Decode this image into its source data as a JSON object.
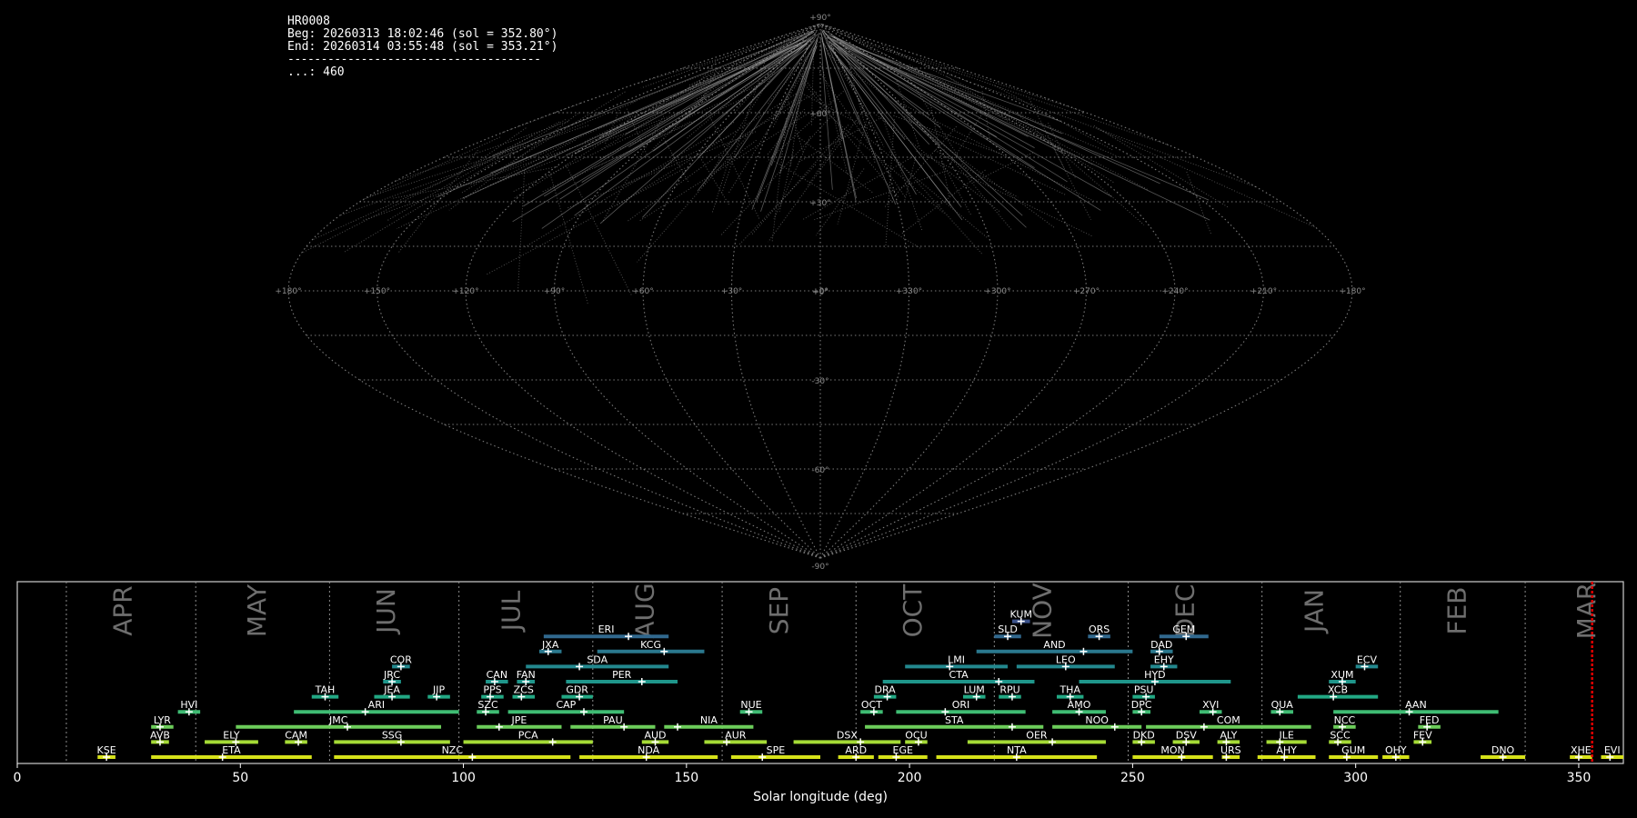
{
  "header": {
    "station": "HR0008",
    "beg": "Beg: 20260313 18:02:46 (sol = 352.80°)",
    "end": "End: 20260314 03:55:48 (sol = 353.21°)",
    "separator": "--------------------------------------",
    "count": "...: 460"
  },
  "sky_map": {
    "projection": "sinusoidal",
    "ra_labels": [
      "+180°",
      "+150°",
      "+120°",
      "+90°",
      "+60°",
      "+30°",
      "+0°",
      "+330°",
      "+300°",
      "+270°",
      "+240°",
      "+210°",
      "+180°"
    ],
    "dec_labels": [
      "+90°",
      "+60°",
      "+30°",
      "+0°",
      "-30°",
      "-60°",
      "-90°"
    ]
  },
  "chart_data": {
    "type": "range",
    "xlabel": "Solar longitude (deg)",
    "xlim": [
      0,
      360
    ],
    "xticks": [
      0,
      50,
      100,
      150,
      200,
      250,
      300,
      350
    ],
    "grid": true,
    "current_sol": 353.0,
    "months": [
      {
        "name": "APR",
        "boundary": 11,
        "label": 24
      },
      {
        "name": "MAY",
        "boundary": 40,
        "label": 54
      },
      {
        "name": "JUN",
        "boundary": 70,
        "label": 83
      },
      {
        "name": "JUL",
        "boundary": 99,
        "label": 111
      },
      {
        "name": "AUG",
        "boundary": 129,
        "label": 141
      },
      {
        "name": "SEP",
        "boundary": 158,
        "label": 171
      },
      {
        "name": "OCT",
        "boundary": 188,
        "label": 201
      },
      {
        "name": "NOV",
        "boundary": 219,
        "label": 230
      },
      {
        "name": "DEC",
        "boundary": 249,
        "label": 262
      },
      {
        "name": "JAN",
        "boundary": 279,
        "label": 291
      },
      {
        "name": "FEB",
        "boundary": 310,
        "label": 323
      },
      {
        "name": "MAR",
        "boundary": 338,
        "label": 352
      }
    ],
    "showers": [
      {
        "code": "KUM",
        "start": 223,
        "end": 227,
        "peak": 225,
        "row": 9
      },
      {
        "code": "ERI",
        "start": 118,
        "end": 146,
        "peak": 137,
        "row": 8
      },
      {
        "code": "SLD",
        "start": 219,
        "end": 225,
        "peak": 222,
        "row": 8
      },
      {
        "code": "ORS",
        "start": 240,
        "end": 245,
        "peak": 242.5,
        "row": 8
      },
      {
        "code": "GEM",
        "start": 256,
        "end": 267,
        "peak": 262,
        "row": 8
      },
      {
        "code": "JXA",
        "start": 117,
        "end": 122,
        "peak": 119,
        "row": 7
      },
      {
        "code": "KCG",
        "start": 130,
        "end": 154,
        "peak": 145,
        "row": 7
      },
      {
        "code": "AND",
        "start": 215,
        "end": 250,
        "peak": 239,
        "row": 7
      },
      {
        "code": "DAD",
        "start": 254,
        "end": 259,
        "peak": 256,
        "row": 7
      },
      {
        "code": "COR",
        "start": 84,
        "end": 88,
        "peak": 86,
        "row": 6
      },
      {
        "code": "SDA",
        "start": 114,
        "end": 146,
        "peak": 126,
        "row": 6
      },
      {
        "code": "LMI",
        "start": 199,
        "end": 222,
        "peak": 209,
        "row": 6
      },
      {
        "code": "LEO",
        "start": 224,
        "end": 246,
        "peak": 235,
        "row": 6
      },
      {
        "code": "EHY",
        "start": 254,
        "end": 260,
        "peak": 257,
        "row": 6
      },
      {
        "code": "ECV",
        "start": 300,
        "end": 305,
        "peak": 302,
        "row": 6
      },
      {
        "code": "JRC",
        "start": 82,
        "end": 86,
        "peak": 84,
        "row": 5
      },
      {
        "code": "CAN",
        "start": 105,
        "end": 110,
        "peak": 107,
        "row": 5
      },
      {
        "code": "FAN",
        "start": 112,
        "end": 116,
        "peak": 114,
        "row": 5
      },
      {
        "code": "PER",
        "start": 123,
        "end": 148,
        "peak": 140,
        "row": 5
      },
      {
        "code": "CTA",
        "start": 194,
        "end": 228,
        "peak": 220,
        "row": 5
      },
      {
        "code": "HYD",
        "start": 238,
        "end": 272,
        "peak": 255,
        "row": 5
      },
      {
        "code": "XUM",
        "start": 294,
        "end": 300,
        "peak": 297,
        "row": 5
      },
      {
        "code": "TAH",
        "start": 66,
        "end": 72,
        "peak": 69,
        "row": 4
      },
      {
        "code": "JEA",
        "start": 80,
        "end": 88,
        "peak": 84,
        "row": 4
      },
      {
        "code": "JIP",
        "start": 92,
        "end": 97,
        "peak": 94,
        "row": 4
      },
      {
        "code": "PPS",
        "start": 104,
        "end": 109,
        "peak": 106,
        "row": 4
      },
      {
        "code": "ZCS",
        "start": 111,
        "end": 116,
        "peak": 113,
        "row": 4
      },
      {
        "code": "GDR",
        "start": 122,
        "end": 129,
        "peak": 126,
        "row": 4
      },
      {
        "code": "DRA",
        "start": 192,
        "end": 197,
        "peak": 195,
        "row": 4
      },
      {
        "code": "LUM",
        "start": 212,
        "end": 217,
        "peak": 215,
        "row": 4
      },
      {
        "code": "RPU",
        "start": 220,
        "end": 225,
        "peak": 223,
        "row": 4
      },
      {
        "code": "THA",
        "start": 233,
        "end": 239,
        "peak": 236,
        "row": 4
      },
      {
        "code": "PSU",
        "start": 250,
        "end": 255,
        "peak": 253,
        "row": 4
      },
      {
        "code": "XCB",
        "start": 287,
        "end": 305,
        "peak": 295,
        "row": 4
      },
      {
        "code": "HVI",
        "start": 36,
        "end": 41,
        "peak": 38.5,
        "row": 3
      },
      {
        "code": "ARI",
        "start": 62,
        "end": 99,
        "peak": 78,
        "row": 3
      },
      {
        "code": "SZC",
        "start": 103,
        "end": 108,
        "peak": 105,
        "row": 3
      },
      {
        "code": "CAP",
        "start": 110,
        "end": 136,
        "peak": 127,
        "row": 3
      },
      {
        "code": "NUE",
        "start": 162,
        "end": 167,
        "peak": 164,
        "row": 3
      },
      {
        "code": "OCT",
        "start": 189,
        "end": 194,
        "peak": 192,
        "row": 3
      },
      {
        "code": "ORI",
        "start": 197,
        "end": 226,
        "peak": 208,
        "row": 3
      },
      {
        "code": "AMO",
        "start": 232,
        "end": 244,
        "peak": 238,
        "row": 3
      },
      {
        "code": "DPC",
        "start": 250,
        "end": 254,
        "peak": 252,
        "row": 3
      },
      {
        "code": "XVI",
        "start": 265,
        "end": 270,
        "peak": 268,
        "row": 3
      },
      {
        "code": "QUA",
        "start": 281,
        "end": 286,
        "peak": 283,
        "row": 3
      },
      {
        "code": "AAN",
        "start": 295,
        "end": 332,
        "peak": 312,
        "row": 3
      },
      {
        "code": "LYR",
        "start": 30,
        "end": 35,
        "peak": 32,
        "row": 2
      },
      {
        "code": "JMC",
        "start": 49,
        "end": 95,
        "peak": 74,
        "row": 2
      },
      {
        "code": "JPE",
        "start": 103,
        "end": 122,
        "peak": 108,
        "row": 2
      },
      {
        "code": "PAU",
        "start": 124,
        "end": 143,
        "peak": 136,
        "row": 2
      },
      {
        "code": "NIA",
        "start": 145,
        "end": 165,
        "peak": 148,
        "row": 2
      },
      {
        "code": "STA",
        "start": 190,
        "end": 230,
        "peak": 223,
        "row": 2
      },
      {
        "code": "NOO",
        "start": 232,
        "end": 252,
        "peak": 246,
        "row": 2
      },
      {
        "code": "COM",
        "start": 253,
        "end": 290,
        "peak": 266,
        "row": 2
      },
      {
        "code": "NCC",
        "start": 295,
        "end": 300,
        "peak": 297,
        "row": 2
      },
      {
        "code": "FED",
        "start": 314,
        "end": 319,
        "peak": 316,
        "row": 2
      },
      {
        "code": "AVB",
        "start": 30,
        "end": 34,
        "peak": 32,
        "row": 1
      },
      {
        "code": "ELY",
        "start": 42,
        "end": 54,
        "peak": 49,
        "row": 1
      },
      {
        "code": "CAM",
        "start": 60,
        "end": 65,
        "peak": 63,
        "row": 1
      },
      {
        "code": "SSG",
        "start": 71,
        "end": 97,
        "peak": 86,
        "row": 1
      },
      {
        "code": "PCA",
        "start": 100,
        "end": 129,
        "peak": 120,
        "row": 1
      },
      {
        "code": "AUD",
        "start": 140,
        "end": 146,
        "peak": 143,
        "row": 1
      },
      {
        "code": "AUR",
        "start": 154,
        "end": 168,
        "peak": 159,
        "row": 1
      },
      {
        "code": "DSX",
        "start": 174,
        "end": 198,
        "peak": 189,
        "row": 1
      },
      {
        "code": "OCU",
        "start": 199,
        "end": 204,
        "peak": 202,
        "row": 1
      },
      {
        "code": "OER",
        "start": 213,
        "end": 244,
        "peak": 232,
        "row": 1
      },
      {
        "code": "DKD",
        "start": 250,
        "end": 255,
        "peak": 252,
        "row": 1
      },
      {
        "code": "DSV",
        "start": 259,
        "end": 265,
        "peak": 262,
        "row": 1
      },
      {
        "code": "ALY",
        "start": 269,
        "end": 274,
        "peak": 271,
        "row": 1
      },
      {
        "code": "ILE",
        "start": 280,
        "end": 289,
        "peak": 283,
        "row": 1
      },
      {
        "code": "SCC",
        "start": 294,
        "end": 299,
        "peak": 296,
        "row": 1
      },
      {
        "code": "FEV",
        "start": 313,
        "end": 317,
        "peak": 315,
        "row": 1
      },
      {
        "code": "KSE",
        "start": 18,
        "end": 22,
        "peak": 20,
        "row": 0
      },
      {
        "code": "ETA",
        "start": 30,
        "end": 66,
        "peak": 46,
        "row": 0
      },
      {
        "code": "NZC",
        "start": 71,
        "end": 124,
        "peak": 102,
        "row": 0
      },
      {
        "code": "NDA",
        "start": 126,
        "end": 157,
        "peak": 141,
        "row": 0
      },
      {
        "code": "SPE",
        "start": 160,
        "end": 180,
        "peak": 167,
        "row": 0
      },
      {
        "code": "ARD",
        "start": 184,
        "end": 192,
        "peak": 188,
        "row": 0
      },
      {
        "code": "EGE",
        "start": 193,
        "end": 204,
        "peak": 197,
        "row": 0
      },
      {
        "code": "NTA",
        "start": 206,
        "end": 242,
        "peak": 224,
        "row": 0
      },
      {
        "code": "MON",
        "start": 250,
        "end": 268,
        "peak": 261,
        "row": 0
      },
      {
        "code": "URS",
        "start": 270,
        "end": 274,
        "peak": 271,
        "row": 0
      },
      {
        "code": "AHY",
        "start": 278,
        "end": 291,
        "peak": 284,
        "row": 0
      },
      {
        "code": "GUM",
        "start": 294,
        "end": 305,
        "peak": 298,
        "row": 0
      },
      {
        "code": "OHY",
        "start": 306,
        "end": 312,
        "peak": 309,
        "row": 0
      },
      {
        "code": "DNO",
        "start": 328,
        "end": 338,
        "peak": 333,
        "row": 0
      },
      {
        "code": "XHE",
        "start": 348,
        "end": 353,
        "peak": 350,
        "row": 0
      },
      {
        "code": "EVI",
        "start": 355,
        "end": 360,
        "peak": 357,
        "row": 0
      }
    ]
  }
}
